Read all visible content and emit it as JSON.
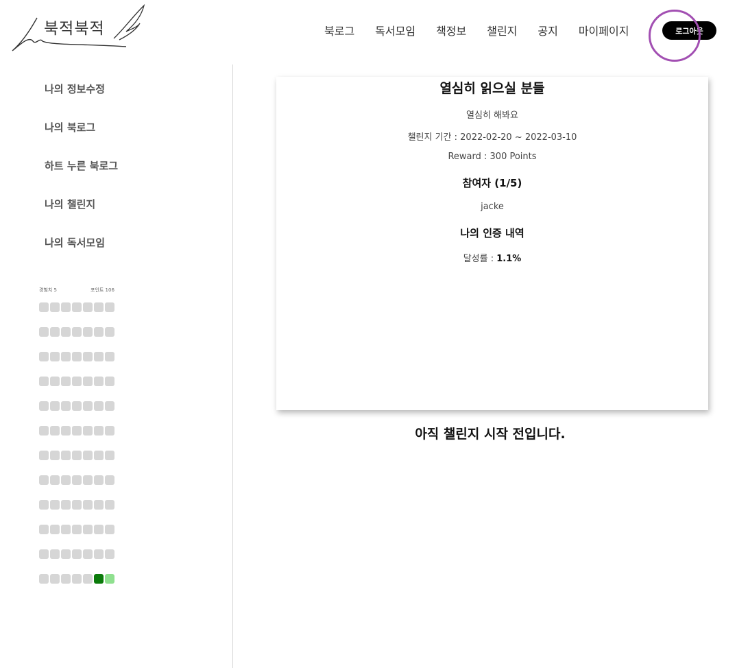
{
  "logo": {
    "text": "북적북적"
  },
  "nav": {
    "items": [
      "북로그",
      "독서모임",
      "책정보",
      "챌린지",
      "공지",
      "마이페이지"
    ],
    "logout_label": "로그아웃"
  },
  "sidebar": {
    "items": [
      "나의 정보수정",
      "나의 북로그",
      "하트 누른 북로그",
      "나의 챌린지",
      "나의 독서모임"
    ],
    "experience_label": "경험치 5",
    "points_label": "포인트 106"
  },
  "heatmap": {
    "rows": 12,
    "cols": 7,
    "active_cells": [
      {
        "row": 11,
        "col": 5,
        "level": "dark"
      },
      {
        "row": 11,
        "col": 6,
        "level": "light"
      }
    ],
    "colors": {
      "empty": "#d6d6d6",
      "dark": "#0a7a0a",
      "light": "#8fe08f"
    }
  },
  "challenge": {
    "title": "열심히 읽으실 분들",
    "description": "열심히 해봐요",
    "period": "챌린지 기간 : 2022-02-20 ~ 2022-03-10",
    "reward": "Reward : 300 Points",
    "participants_heading": "참여자 (1/5)",
    "participants": [
      "jacke"
    ],
    "my_cert_heading": "나의 인증 내역",
    "achievement_label": "달성률 : ",
    "achievement_value": "1.1%"
  },
  "status_message": "아직 챌린지 시작 전입니다.",
  "colors": {
    "accent": "#a24fb2",
    "button_bg": "#000000"
  }
}
